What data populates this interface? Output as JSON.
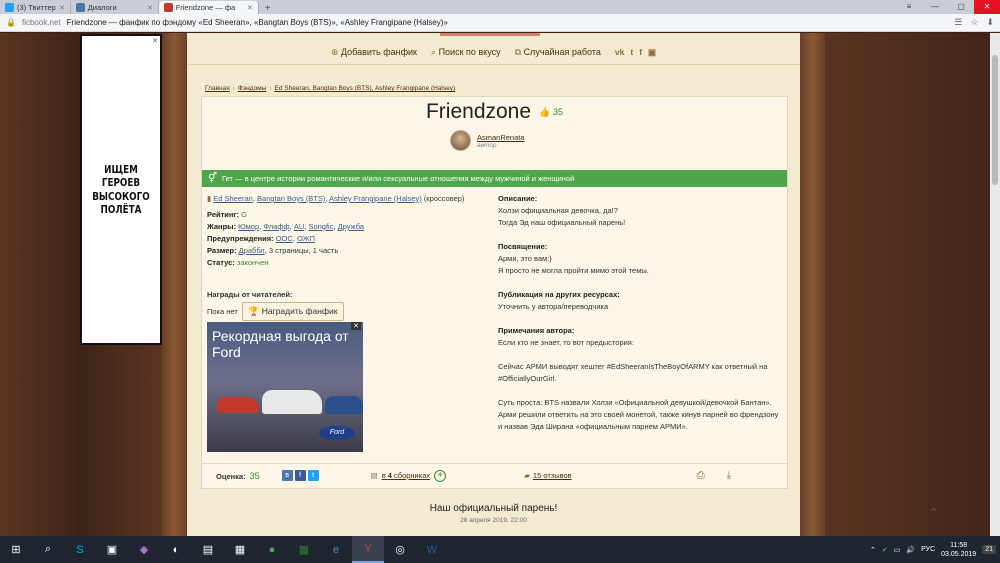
{
  "browser": {
    "tabs": [
      {
        "label": "(3) Твиттер",
        "color": "#1da1f2"
      },
      {
        "label": "Диалоги",
        "color": "#4a76a8"
      },
      {
        "label": "Friendzone — фа",
        "color": "#c0392b",
        "active": true
      }
    ],
    "new_tab": "+",
    "domain": "ficbook.net",
    "page_title": "Friendzone — фанфик по фэндому «Ed Sheeran», «Bangtan Boys (BTS)», «Ashley Frangipane (Halsey)»"
  },
  "banner": {
    "text": "ИЩЕМ ГЕРОЕВ ВЫСОКОГО ПОЛЁТА"
  },
  "topnav": {
    "add": "Добавить фанфик",
    "search": "Поиск по вкусу",
    "random": "Случайная работа",
    "social": [
      "vk",
      "t",
      "f",
      "▣"
    ]
  },
  "breadcrumbs": [
    "Главная",
    "Фэндомы",
    "Ed Sheeran, Bangtan Boys (BTS), Ashley Frangipane (Halsey)"
  ],
  "work": {
    "title": "Friendzone",
    "likes": "35",
    "author_name": "AsmanRenata",
    "author_role": "автор",
    "direction": "Гет — в центре истории романтические и/или сексуальные отношения между мужчиной и женщиной",
    "fandoms": [
      "Ed Sheeran",
      "Bangtan Boys (BTS)",
      "Ashley Frangipane (Halsey)"
    ],
    "crossover": "(кроссовер)",
    "rating_label": "Рейтинг:",
    "rating": "G",
    "genres_label": "Жанры:",
    "genres": [
      "Юмор",
      "Флафф",
      "AU",
      "Songfic",
      "Дружба"
    ],
    "warnings_label": "Предупреждения:",
    "warnings": [
      "ООС",
      "ОЖП"
    ],
    "size_label": "Размер:",
    "size_link": "Драббл",
    "size_rest": ", 3 страницы, 1 часть",
    "status_label": "Статус:",
    "status": "закончен",
    "awards_label": "Награды от читателей:",
    "awards_none": "Пока нет",
    "award_button": "Наградить фанфик",
    "description_label": "Описание:",
    "description_lines": [
      "Холзи официальная девочка, да!?",
      "Тогда Эд наш официальный парень!"
    ],
    "dedication_label": "Посвящение:",
    "dedication_lines": [
      "Арми, это вам:)",
      "Я просто не могла пройти мимо этой темы."
    ],
    "publication_label": "Публикация на других ресурсах:",
    "publication": "Уточнить у автора/переводчика",
    "notes_label": "Примечания автора:",
    "notes_1": "Если кто не знает, то вот предыстория:",
    "notes_2": "Сейчас АРМИ выводят хештег #EdSheeranIsTheBoyOfARMY как ответный на #OfficiallyOurGirl.",
    "notes_3": "Суть проста: BTS назвали Холзи «Официальной девушкой/девочкой Бантан». Арми решили ответить на это своей монетой, также кинув парней во френдзону и назвав Эда Ширана «официальным парнем АРМИ».",
    "score_label": "Оценка:",
    "score": "35",
    "collections_prefix": "в",
    "collections_count": "4",
    "collections_suffix": "сборниках",
    "reviews": "15 отзывов"
  },
  "ad": {
    "headline": "Рекордная выгода от Ford",
    "logo": "Ford",
    "close": "✕"
  },
  "chapter": {
    "title": "Наш официальный парень!",
    "date": "28 апреля 2019, 22:00"
  },
  "taskbar": {
    "lang": "РУС",
    "time": "11:58",
    "date": "03.05.2019",
    "notif": "21"
  }
}
